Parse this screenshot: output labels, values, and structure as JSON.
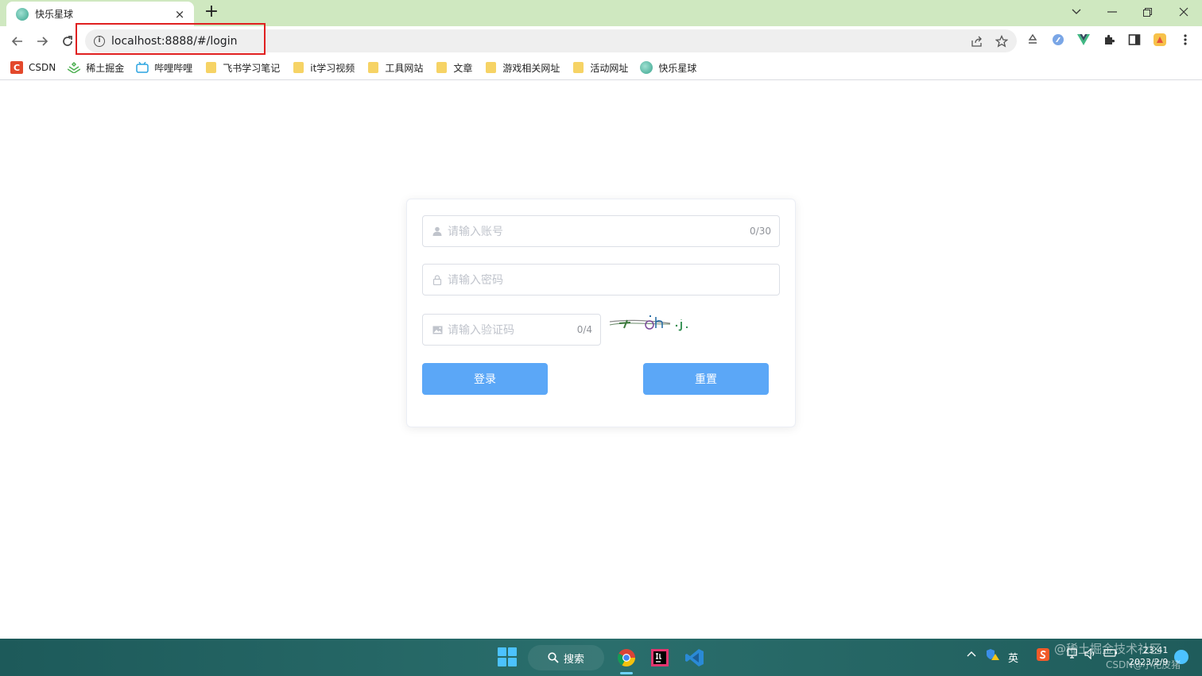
{
  "browser": {
    "tab_title": "快乐星球",
    "tab_close": "×",
    "new_tab": "+",
    "url": "localhost:8888/#/login"
  },
  "bookmarks": [
    {
      "label": "CSDN",
      "icon": "csdn-icon"
    },
    {
      "label": "稀土掘金",
      "icon": "juejin-icon"
    },
    {
      "label": "哔哩哔哩",
      "icon": "bilibili-icon"
    },
    {
      "label": "飞书学习笔记",
      "icon": "folder-icon"
    },
    {
      "label": "it学习视频",
      "icon": "folder-icon"
    },
    {
      "label": "工具网站",
      "icon": "folder-icon"
    },
    {
      "label": "文章",
      "icon": "folder-icon"
    },
    {
      "label": "游戏相关网址",
      "icon": "folder-icon"
    },
    {
      "label": "活动网址",
      "icon": "folder-icon"
    },
    {
      "label": "快乐星球",
      "icon": "planet-icon"
    }
  ],
  "login": {
    "account_placeholder": "请输入账号",
    "account_count": "0/30",
    "password_placeholder": "请输入密码",
    "captcha_placeholder": "请输入验证码",
    "captcha_count": "0/4",
    "login_button": "登录",
    "reset_button": "重置"
  },
  "taskbar": {
    "search_label": "搜索",
    "ime": "英",
    "time": "23:41",
    "date": "2023/2/9"
  },
  "watermark": {
    "line1": "@稀土掘金技术社区",
    "line2": "CSDN@小花皮猪"
  },
  "colors": {
    "tabstrip": "#cfe8c0",
    "button_blue": "#5ba7f7",
    "highlight_red": "#e02020"
  }
}
